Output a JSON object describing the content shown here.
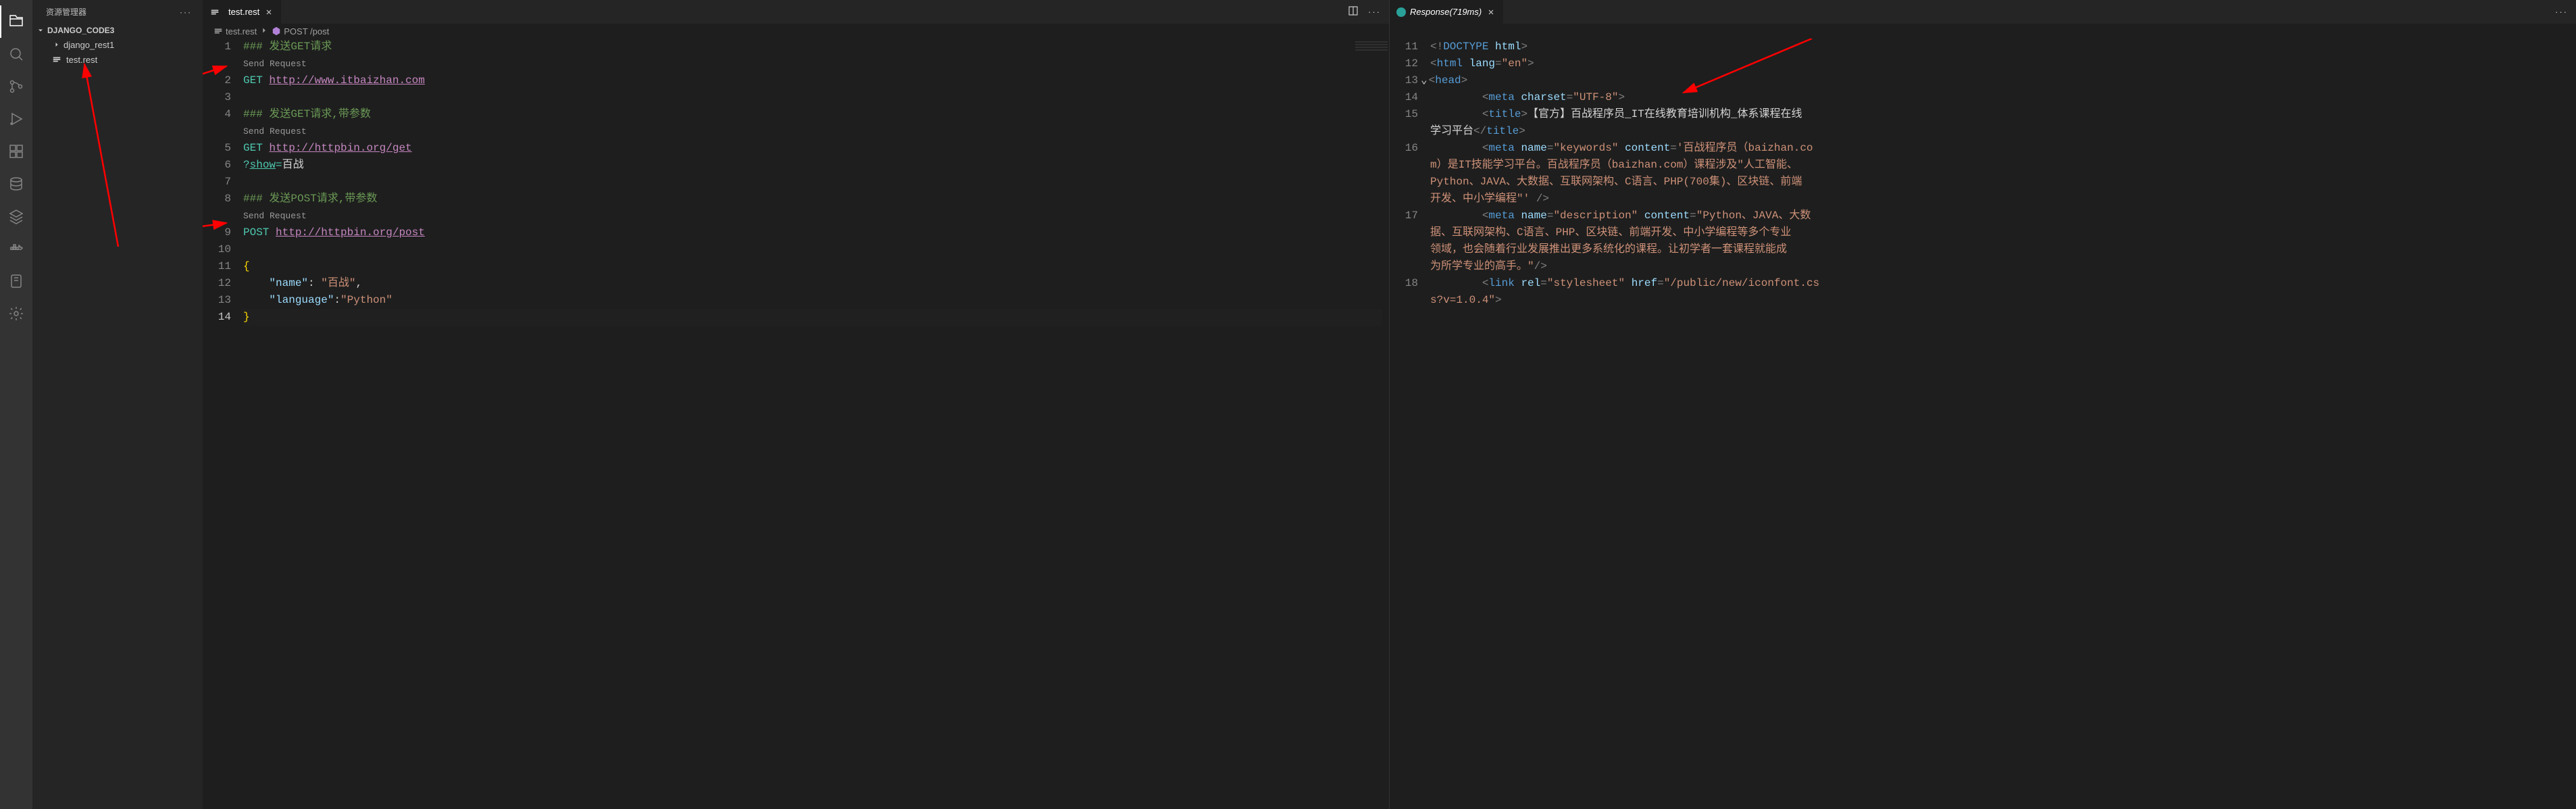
{
  "activityBar": {
    "items": [
      {
        "name": "explorer-icon",
        "active": true
      },
      {
        "name": "search-icon",
        "active": false
      },
      {
        "name": "source-control-icon",
        "active": false
      },
      {
        "name": "run-debug-icon",
        "active": false
      },
      {
        "name": "extensions-icon",
        "active": false
      },
      {
        "name": "database-icon",
        "active": false
      },
      {
        "name": "layers-icon",
        "active": false
      },
      {
        "name": "docker-icon",
        "active": false
      },
      {
        "name": "book-icon",
        "active": false
      },
      {
        "name": "settings-icon",
        "active": false
      }
    ]
  },
  "sidebar": {
    "title": "资源管理器",
    "root": "DJANGO_CODE3",
    "items": [
      {
        "name": "django_rest1",
        "type": "folder"
      },
      {
        "name": "test.rest",
        "type": "file"
      }
    ]
  },
  "editor1": {
    "tab": {
      "label": "test.rest",
      "icon": "rest-file-icon"
    },
    "breadcrumbs": [
      {
        "label": "test.rest",
        "icon": "rest-file-icon"
      },
      {
        "label": "POST /post",
        "icon": "symbol-method-icon"
      }
    ],
    "lines": {
      "1": {
        "type": "comment",
        "text": "### 发送GET请求"
      },
      "2": {
        "type": "codelens",
        "text": "Send Request"
      },
      "3": {
        "type": "request",
        "method": "GET",
        "url": "http://www.itbaizhan.com",
        "n": "2"
      },
      "4": {
        "n": "3",
        "text": ""
      },
      "5": {
        "type": "comment",
        "n": "4",
        "text": "### 发送GET请求,带参数"
      },
      "6": {
        "type": "codelens",
        "text": "Send Request"
      },
      "7": {
        "type": "request",
        "n": "5",
        "method": "GET",
        "url": "http://httpbin.org/get"
      },
      "8": {
        "type": "query",
        "n": "6",
        "raw": "?show=百战"
      },
      "9": {
        "n": "7",
        "text": ""
      },
      "10": {
        "type": "comment",
        "n": "8",
        "text": "### 发送POST请求,带参数"
      },
      "11": {
        "type": "codelens",
        "text": "Send Request"
      },
      "12": {
        "type": "request",
        "n": "9",
        "method": "POST",
        "url": "http://httpbin.org/post"
      },
      "13": {
        "n": "10",
        "text": ""
      },
      "14": {
        "type": "brace",
        "n": "11",
        "text": "{"
      },
      "15": {
        "type": "json",
        "n": "12",
        "key": "\"name\"",
        "val": "\"百战\"",
        "comma": ","
      },
      "16": {
        "type": "json",
        "n": "13",
        "key": "\"language\"",
        "val": "\"Python\"",
        "comma": ""
      },
      "17": {
        "type": "brace",
        "n": "14",
        "text": "}"
      }
    }
  },
  "editor2": {
    "tab": {
      "label": "Response(719ms)",
      "icon": "response-icon"
    },
    "lines": [
      {
        "n": "11",
        "html": "<span class='tok-punc'>&lt;!</span><span class='tok-doctype'>DOCTYPE</span> <span class='tok-attrname'>html</span><span class='tok-punc'>&gt;</span>"
      },
      {
        "n": "12",
        "html": "<span class='tok-punc'>&lt;</span><span class='tok-tag'>html</span> <span class='tok-attrname'>lang</span><span class='tok-punc'>=</span><span class='tok-attrval'>\"en\"</span><span class='tok-punc'>&gt;</span>"
      },
      {
        "n": "13",
        "fold": true,
        "html": "<span class='tok-punc'>&lt;</span><span class='tok-tag'>head</span><span class='tok-punc'>&gt;</span>"
      },
      {
        "n": "14",
        "indent": "        ",
        "html": "<span class='tok-punc'>&lt;</span><span class='tok-tag'>meta</span> <span class='tok-attrname'>charset</span><span class='tok-punc'>=</span><span class='tok-attrval'>\"UTF-8\"</span><span class='tok-punc'>&gt;</span>"
      },
      {
        "n": "15",
        "indent": "        ",
        "html": "<span class='tok-punc'>&lt;</span><span class='tok-tag'>title</span><span class='tok-punc'>&gt;</span><span class='tok-text'>【官方】百战程序员_IT在线教育培训机构_体系课程在线</span>"
      },
      {
        "n": "",
        "indent": "",
        "html": "<span class='tok-text'>学习平台</span><span class='tok-punc'>&lt;/</span><span class='tok-tag'>title</span><span class='tok-punc'>&gt;</span>"
      },
      {
        "n": "16",
        "indent": "        ",
        "html": "<span class='tok-punc'>&lt;</span><span class='tok-tag'>meta</span> <span class='tok-attrname'>name</span><span class='tok-punc'>=</span><span class='tok-attrval'>\"keywords\"</span> <span class='tok-attrname'>content</span><span class='tok-punc'>=</span><span class='tok-attrval'>'百战程序员（baizhan.co</span>"
      },
      {
        "n": "",
        "indent": "",
        "html": "<span class='tok-attrval'>m）是IT技能学习平台。百战程序员（baizhan.com）课程涉及\"人工智能、</span>"
      },
      {
        "n": "",
        "indent": "",
        "html": "<span class='tok-attrval'>Python、JAVA、大数据、互联网架构、C语言、PHP(700集)、区块链、前端</span>"
      },
      {
        "n": "",
        "indent": "",
        "html": "<span class='tok-attrval'>开发、中小学编程\"'</span> <span class='tok-punc'>/&gt;</span>"
      },
      {
        "n": "17",
        "indent": "        ",
        "html": "<span class='tok-punc'>&lt;</span><span class='tok-tag'>meta</span> <span class='tok-attrname'>name</span><span class='tok-punc'>=</span><span class='tok-attrval'>\"description\"</span> <span class='tok-attrname'>content</span><span class='tok-punc'>=</span><span class='tok-attrval'>\"Python、JAVA、大数</span>"
      },
      {
        "n": "",
        "indent": "",
        "html": "<span class='tok-attrval'>据、互联网架构、C语言、PHP、区块链、前端开发、中小学编程等多个专业</span>"
      },
      {
        "n": "",
        "indent": "",
        "html": "<span class='tok-attrval'>领域，也会随着行业发展推出更多系统化的课程。让初学者一套课程就能成</span>"
      },
      {
        "n": "",
        "indent": "",
        "html": "<span class='tok-attrval'>为所学专业的高手。\"</span><span class='tok-punc'>/&gt;</span>"
      },
      {
        "n": "18",
        "indent": "        ",
        "html": "<span class='tok-punc'>&lt;</span><span class='tok-tag'>link</span> <span class='tok-attrname'>rel</span><span class='tok-punc'>=</span><span class='tok-attrval'>\"stylesheet\"</span> <span class='tok-attrname'>href</span><span class='tok-punc'>=</span><span class='tok-attrval'>\"/public/new/iconfont.cs</span>"
      },
      {
        "n": "",
        "indent": "",
        "html": "<span class='tok-attrval'>s?v=1.0.4\"</span><span class='tok-punc'>&gt;</span>"
      }
    ]
  }
}
